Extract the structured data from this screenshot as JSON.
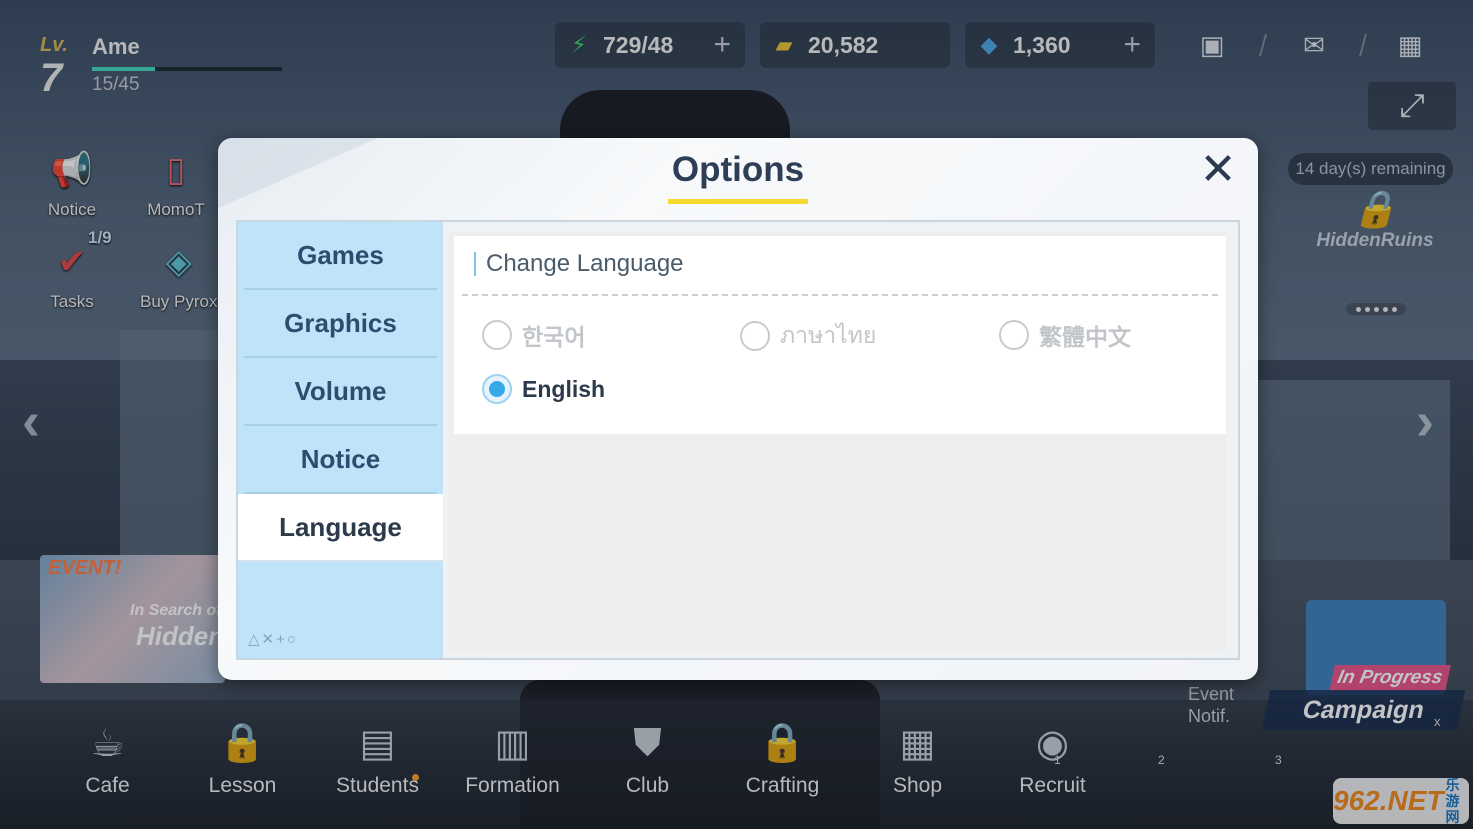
{
  "hud": {
    "lv_label": "Lv.",
    "level": "7",
    "player_name": "Ame",
    "xp_text": "15/45",
    "xp_fraction": 0.33,
    "ap": "729/48",
    "credits": "20,582",
    "pyroxene": "1,360"
  },
  "left_icons": {
    "notice": "Notice",
    "momotalk": "MomoT",
    "tasks_badge": "1/9",
    "tasks": "Tasks",
    "buy_pyroxene": "Buy Pyrox"
  },
  "event_banner": {
    "tag": "EVENT!",
    "line1": "In Search of",
    "line2": "Hidden"
  },
  "right_panel": {
    "remaining": "14 day(s) remaining",
    "hidden_ruins": "HiddenRuins",
    "in_progress": "In Progress",
    "campaign": "Campaign",
    "event_notif_1": "Event",
    "event_notif_2": "Notif.",
    "close_x": "x"
  },
  "bottom_nav": {
    "items": [
      "Cafe",
      "Lesson",
      "Students",
      "Formation",
      "Club",
      "Crafting",
      "Shop",
      "Recruit"
    ],
    "numbers": [
      "1",
      "2",
      "3"
    ]
  },
  "watermark": {
    "main": "962.NET",
    "sub": "乐游网"
  },
  "modal": {
    "title": "Options",
    "close_symbol": "✕",
    "tabs": [
      "Games",
      "Graphics",
      "Volume",
      "Notice",
      "Language"
    ],
    "active_tab": "Language",
    "tab_deco": "△✕+○",
    "section_title": "Change Language",
    "languages": [
      "한국어",
      "ภาษาไทย",
      "繁體中文",
      "English"
    ],
    "selected_language": "English"
  },
  "colors": {
    "accent_blue": "#37a9e9",
    "title_underline": "#f5d92e",
    "tab_bg": "#bfe3f9",
    "title_text": "#2e3e56"
  }
}
